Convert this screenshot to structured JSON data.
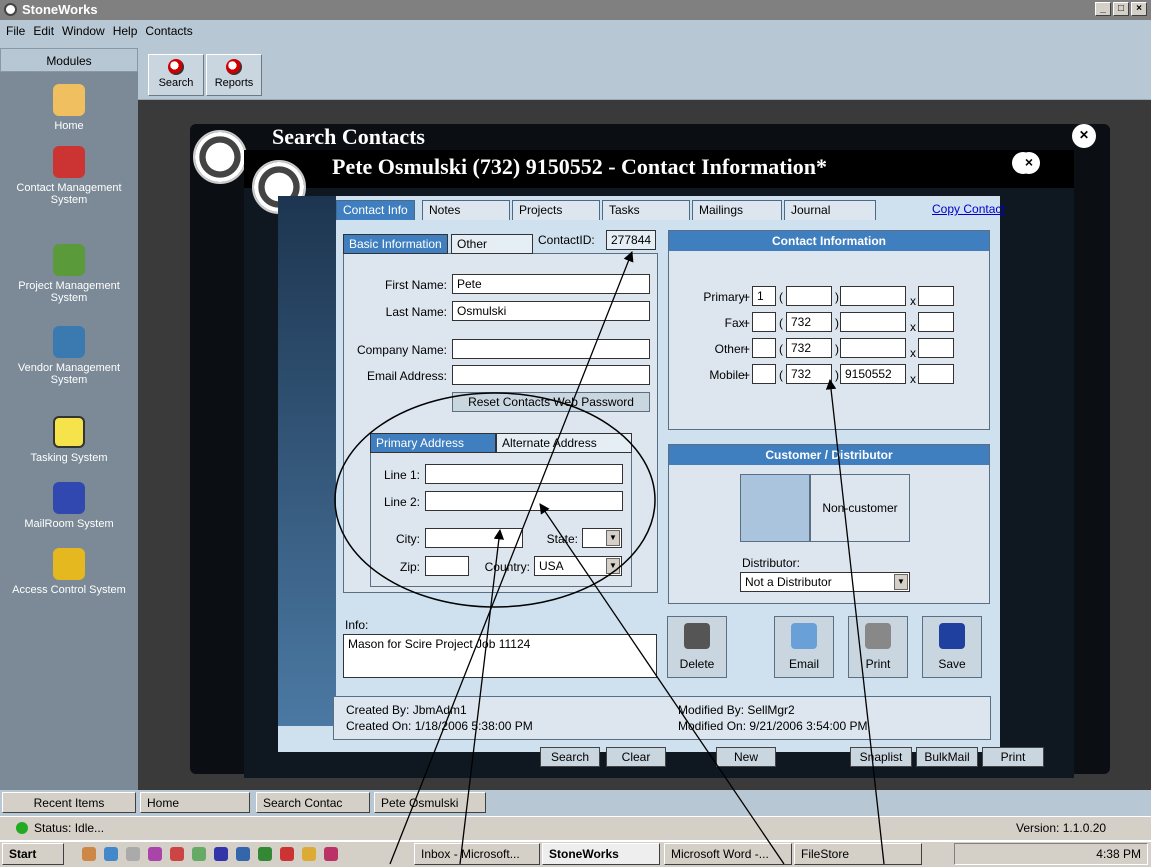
{
  "window": {
    "title": "StoneWorks"
  },
  "menu": [
    "File",
    "Edit",
    "Window",
    "Help",
    "Contacts"
  ],
  "toolbar": {
    "search_label": "Search",
    "reports_label": "Reports"
  },
  "modules": {
    "header": "Modules",
    "items": [
      {
        "label": "Home",
        "icon": "home-icon"
      },
      {
        "label": "Contact Management System",
        "icon": "contact-icon"
      },
      {
        "label": "Project Management System",
        "icon": "pencil-icon"
      },
      {
        "label": "Vendor Management System",
        "icon": "handshake-icon"
      },
      {
        "label": "Tasking System",
        "icon": "checkbox-icon"
      },
      {
        "label": "MailRoom System",
        "icon": "envelope-icon"
      },
      {
        "label": "Access Control System",
        "icon": "lock-icon"
      }
    ]
  },
  "back_window": {
    "title": "Search Contacts"
  },
  "contact_window": {
    "title": "Pete Osmulski (732) 9150552 - Contact Information*",
    "tabs": [
      "Contact Info",
      "Notes",
      "Projects",
      "Tasks",
      "Mailings",
      "Journal"
    ],
    "copy_contact": "Copy Contact",
    "basic": {
      "tab_basic": "Basic Information",
      "tab_other": "Other",
      "contactid_label": "ContactID:",
      "contactid": "277844",
      "first_name_label": "First Name:",
      "first_name": "Pete",
      "last_name_label": "Last Name:",
      "last_name": "Osmulski",
      "company_label": "Company Name:",
      "company": "",
      "email_label": "Email Address:",
      "email": "",
      "reset_button": "Reset Contacts Web Password"
    },
    "address": {
      "tab_primary": "Primary Address",
      "tab_alternate": "Alternate Address",
      "line1_label": "Line 1:",
      "line2_label": "Line 2:",
      "city_label": "City:",
      "state_label": "State:",
      "zip_label": "Zip:",
      "country_label": "Country:",
      "country": "USA"
    },
    "contact_info": {
      "header": "Contact Information",
      "primary_label": "Primary:",
      "fax_label": "Fax:",
      "other_label": "Other:",
      "mobile_label": "Mobile:",
      "primary_country": "1",
      "fax_area": "732",
      "other_area": "732",
      "mobile_area": "732",
      "mobile_number": "9150552",
      "plus": "+",
      "x": "x",
      "lparen": "(",
      "rparen": ")"
    },
    "customer": {
      "header": "Customer / Distributor",
      "status": "Non-customer",
      "distributor_label": "Distributor:",
      "distributor": "Not a Distributor"
    },
    "info": {
      "label": "Info:",
      "text": "Mason for Scire Project Job 11124"
    },
    "actions": {
      "delete": "Delete",
      "email": "Email",
      "print": "Print",
      "save": "Save"
    },
    "audit": {
      "created_by": "Created By: JbmAdm1",
      "created_on": "Created On: 1/18/2006 5:38:00 PM",
      "modified_by": "Modified By: SellMgr2",
      "modified_on": "Modified On: 9/21/2006 3:54:00 PM"
    }
  },
  "search_buttons": [
    "Search",
    "Clear",
    "New",
    "Snaplist",
    "BulkMail",
    "Print"
  ],
  "recent": {
    "label": "Recent Items",
    "items": [
      "Home",
      "Search Contac",
      "Pete Osmulski"
    ]
  },
  "status": {
    "text": "Status: Idle...",
    "version": "Version: 1.1.0.20"
  },
  "taskbar": {
    "start": "Start",
    "items": [
      "Inbox - Microsoft...",
      "StoneWorks",
      "Microsoft Word -...",
      "FileStore"
    ],
    "clock": "4:38 PM"
  }
}
